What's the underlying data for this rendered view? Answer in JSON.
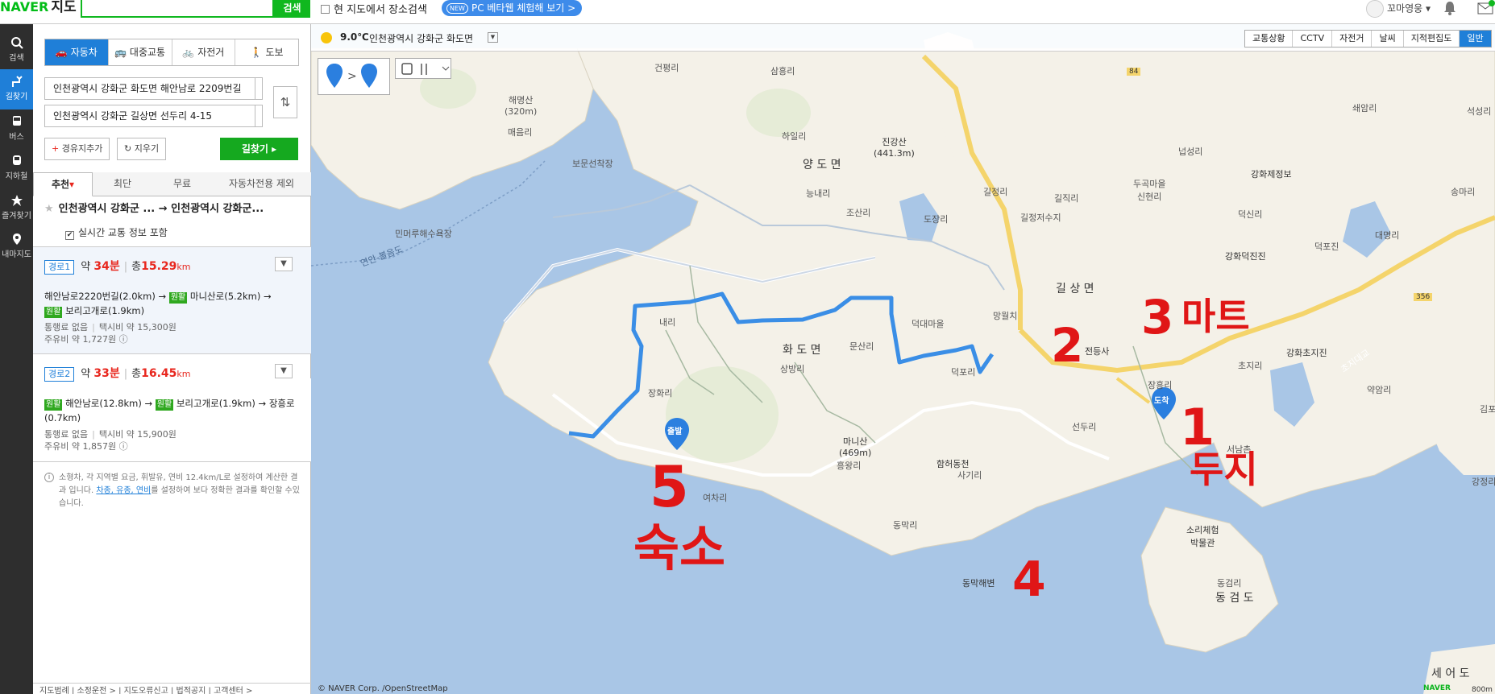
{
  "brand": {
    "logo": "NAVER",
    "service": "지도"
  },
  "search": {
    "button": "검색",
    "placeholder": "",
    "current_map_search": "현 지도에서 장소검색",
    "beta_new": "NEW",
    "beta_label": "PC 베타웹 체험해 보기 >"
  },
  "user": {
    "name": "꼬마영웅"
  },
  "nav": {
    "search": "검색",
    "directions": "길찾기",
    "bus": "버스",
    "subway": "지하철",
    "favorites": "즐겨찾기",
    "my_map": "내마지도"
  },
  "modes": {
    "car": "자동차",
    "transit": "대중교통",
    "bike": "자전거",
    "walk": "도보"
  },
  "route_form": {
    "origin": "인천광역시 강화군 화도면 해안남로 2209번길",
    "destination": "인천광역시 강화군 길상면 선두리 4-15",
    "add_waypoint": "경유지추가",
    "clear": "지우기",
    "go": "길찾기"
  },
  "sort_tabs": {
    "recommended": "추천",
    "shortest": "최단",
    "free": "무료",
    "exclude_highway": "자동차전용 제외"
  },
  "summary": {
    "title": "인천광역시 강화군 ... → 인천광역시 강화군...",
    "realtime": "실시간 교통 정보 포함"
  },
  "routes": [
    {
      "badge": "경로1",
      "time_prefix": "약",
      "time": "34분",
      "dist_prefix": "총",
      "dist": "15.29",
      "unit": "km",
      "seg1": "해안남로2220번길(2.0km) →",
      "tag": "원활",
      "seg2": "마니산로(5.2km) →",
      "seg3": "보리고개로(1.9km)",
      "toll": "통행료 없음",
      "taxi": "택시비 약 15,300원",
      "fuel": "주유비 약 1,727원"
    },
    {
      "badge": "경로2",
      "time_prefix": "약",
      "time": "33분",
      "dist_prefix": "총",
      "dist": "16.45",
      "unit": "km",
      "seg1": "해안남로(12.8km) →",
      "tag": "원활",
      "seg2": "보리고개로(1.9km) → 장흥로(0.7km)",
      "seg3": "",
      "toll": "통행료 없음",
      "taxi": "택시비 약 15,900원",
      "fuel": "주유비 약 1,857원"
    }
  ],
  "note": {
    "text1": "소형차, 각 지역별 요금, 휘발유, 연비 12.4km/L로 설정하여 계산한 결과 입니다.",
    "link": "차종, 유종, 연비",
    "text2": "를 설정하여 보다 정확한 결과를 확인할 수있습니다."
  },
  "footer": {
    "items": "지도범례 | 소정운전 > | 지도오류신고 | 법적공지 | 고객센터 >"
  },
  "weather": {
    "temp": "9.0℃",
    "location": "인천광역시 강화군 화도면"
  },
  "layers": [
    "교통상황",
    "CCTV",
    "자전거",
    "날씨",
    "지적편집도",
    "일반"
  ],
  "markers": {
    "start": "출발",
    "end": "도착"
  },
  "map_labels": {
    "haemyeongsan": "해명산\n(320m)",
    "maeeumri": "매음리",
    "bomun": "보문선착장",
    "minmeoru": "민머루해수욕장",
    "geonpyeongri": "건평리",
    "samheungri": "삼흥리",
    "hailri": "하일리",
    "yangdomyeon": "양 도 면",
    "neungnaeri": "능내리",
    "josanri": "조산리",
    "jingangsan": "진강산\n(441.3m)",
    "dojangri": "도장리",
    "giljeongri": "길정리",
    "giljeongreservoir": "길정저수지",
    "giljikri": "길직리",
    "dugumaeul": "두곡마을\n신현리",
    "nepseongri": "넙성리",
    "ganghwa_gyeongseongbo": "강화제정보",
    "ganghwa_deokjinjin": "강화덕진진",
    "deokpojin": "덕포진",
    "deoksinri": "덕신리",
    "deokdaemaeul": "덕대마을",
    "mangwolchi": "망월치",
    "gilsangmyeon": "길 상 면",
    "hwadomyeon": "화 도 면",
    "naeri": "내리",
    "mundori": "문산리",
    "sangbangri": "상방리",
    "janghwari": "장화리",
    "deokpori": "덕포리",
    "jeondeungsa": "전등사",
    "janghungri": "장흥리",
    "seondori": "선두리",
    "manisan": "마니산\n(469m)",
    "heungwangri": "흥왕리",
    "hamheodongcheon": "함허동천",
    "sagiri": "사기리",
    "yeochari": "여차리",
    "dongmakri": "동막리",
    "dongmak_beach": "동막해변",
    "sobaei": "소리체험\n박물관",
    "seonamchon": "서남촌",
    "chojiri": "초지리",
    "ganghwa_chojijin": "강화초지진",
    "chojidaegyo": "초지대교",
    "yakamri": "약암리",
    "dongeomri": "동검리",
    "dongeomdo": "동 검 도",
    "seeodo": "세 어 도",
    "seokdaeri": "석성리",
    "songmari": "송마리",
    "daemyeongri": "대명리",
    "soeamri": "쇄암리",
    "gimpo": "김포",
    "gangjeongri": "강정리",
    "yeonan_route": "연안-볼음도",
    "road84": "84",
    "road356": "356"
  },
  "handwriting": {
    "num1": "1",
    "word1": "두지",
    "num2": "2",
    "num3": "3",
    "word3": "마트",
    "num4": "4",
    "num5": "5",
    "word5": "숙소"
  },
  "map_footer": {
    "copyright": "© NAVER Corp. /OpenStreetMap",
    "naver": "NAVER",
    "scale": "800m"
  }
}
